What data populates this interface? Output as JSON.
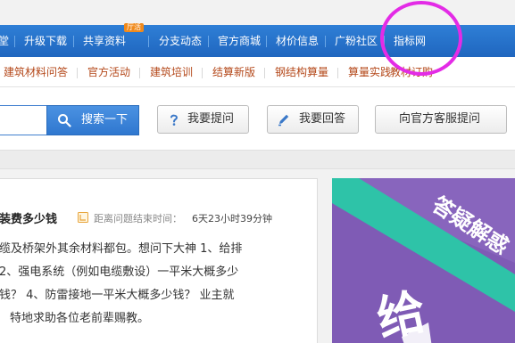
{
  "topnav": {
    "items": [
      "堂",
      "升级下载",
      "共享资料",
      "分支动态",
      "官方商城",
      "材价信息",
      "广粉社区",
      "指标网"
    ],
    "badge": "厅活"
  },
  "subnav": {
    "links": [
      "建筑材料问答",
      "官方活动",
      "建筑培训",
      "结算新版",
      "钢结构算量",
      "算量实践",
      "教材订购"
    ]
  },
  "search": {
    "value": "",
    "button_label": "搜索一下"
  },
  "actions": {
    "ask_label": "我要提问",
    "answer_label": "我要回答",
    "service_label": "向官方客服提问"
  },
  "question": {
    "title": "装费多少钱",
    "time_label": "距离问题结束时间：",
    "time_value": "6天23小时39分钟",
    "lines": [
      "缆及桥架外其余材料都包。想问下大神 1、给排",
      "2、强电系统（例如电缆敷设）一平米大概多少",
      "钱？ 4、防雷接地一平米大概多少钱？ 业主就",
      "特地求助各位老前辈赐教。"
    ]
  },
  "banner": {
    "ribbon_text": "答疑解惑",
    "big_text": "给"
  },
  "colors": {
    "nav_blue": "#2f7fd6",
    "link_orange": "#b4481a",
    "banner_purple": "#7f5bb5",
    "banner_teal": "#2ec3a8",
    "annotation_magenta": "#e32be6"
  }
}
